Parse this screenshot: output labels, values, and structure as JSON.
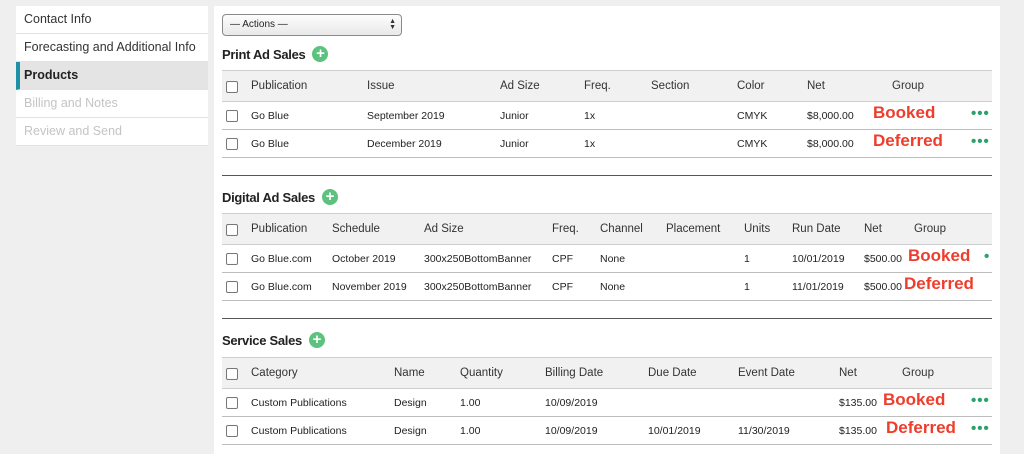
{
  "sidebar": {
    "items": [
      {
        "label": "Contact Info"
      },
      {
        "label": "Forecasting and Additional Info"
      },
      {
        "label": "Products"
      },
      {
        "label": "Billing and Notes"
      },
      {
        "label": "Review and Send"
      }
    ]
  },
  "actions": {
    "label": "— Actions —"
  },
  "print": {
    "title": "Print Ad Sales",
    "headers": [
      "Publication",
      "Issue",
      "Ad Size",
      "Freq.",
      "Section",
      "Color",
      "Net",
      "Group"
    ],
    "rows": [
      {
        "publication": "Go Blue",
        "issue": "September 2019",
        "ad_size": "Junior",
        "freq": "1x",
        "section": "",
        "color": "CMYK",
        "net": "$8,000.00",
        "group": "Booked"
      },
      {
        "publication": "Go Blue",
        "issue": "December 2019",
        "ad_size": "Junior",
        "freq": "1x",
        "section": "",
        "color": "CMYK",
        "net": "$8,000.00",
        "group": "Deferred"
      }
    ]
  },
  "digital": {
    "title": "Digital Ad Sales",
    "headers": [
      "Publication",
      "Schedule",
      "Ad Size",
      "Freq.",
      "Channel",
      "Placement",
      "Units",
      "Run Date",
      "Net",
      "Group"
    ],
    "rows": [
      {
        "publication": "Go Blue.com",
        "schedule": "October 2019",
        "ad_size": "300x250BottomBanner",
        "freq": "CPF",
        "channel": "None",
        "placement": "",
        "units": "1",
        "run_date": "10/01/2019",
        "net": "$500.00",
        "group": "Booked"
      },
      {
        "publication": "Go Blue.com",
        "schedule": "November 2019",
        "ad_size": "300x250BottomBanner",
        "freq": "CPF",
        "channel": "None",
        "placement": "",
        "units": "1",
        "run_date": "11/01/2019",
        "net": "$500.00",
        "group": "Deferred"
      }
    ]
  },
  "service": {
    "title": "Service Sales",
    "headers": [
      "Category",
      "Name",
      "Quantity",
      "Billing Date",
      "Due Date",
      "Event Date",
      "Net",
      "Group"
    ],
    "rows": [
      {
        "category": "Custom Publications",
        "name": "Design",
        "quantity": "1.00",
        "billing_date": "10/09/2019",
        "due_date": "",
        "event_date": "",
        "net": "$135.00",
        "group": "Booked"
      },
      {
        "category": "Custom Publications",
        "name": "Design",
        "quantity": "1.00",
        "billing_date": "10/09/2019",
        "due_date": "10/01/2019",
        "event_date": "11/30/2019",
        "net": "$135.00",
        "group": "Deferred"
      }
    ]
  },
  "icons": {
    "add": "plus-circle-icon",
    "more": "more-dots-icon",
    "select_arrows": "up-down-arrows-icon"
  },
  "colors": {
    "accent": "#1e90a8",
    "add_button": "#5cc27e",
    "group_label": "#ee3d2c",
    "more_dots": "#2aa36a"
  }
}
